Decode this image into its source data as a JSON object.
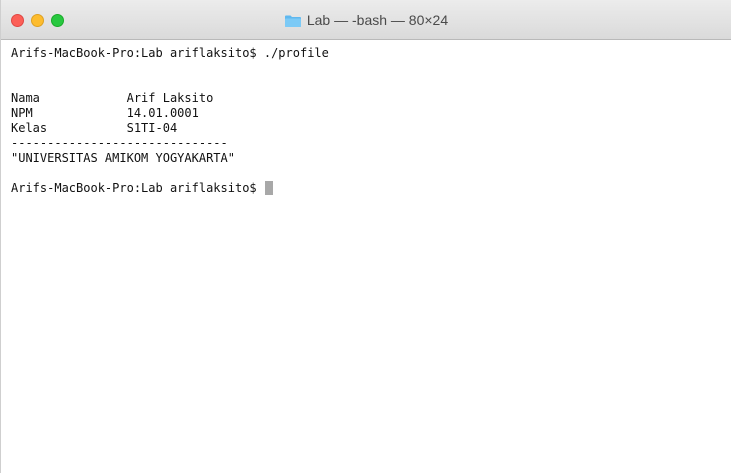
{
  "window": {
    "title": "Lab — -bash — 80×24",
    "folder_icon": "folder-icon",
    "buttons": {
      "close": "close-icon",
      "minimize": "minimize-icon",
      "zoom": "zoom-icon"
    }
  },
  "terminal": {
    "lines": [
      "Arifs-MacBook-Pro:Lab ariflaksito$ ./profile",
      "",
      "",
      "Nama            Arif Laksito",
      "NPM             14.01.0001",
      "Kelas           S1TI-04",
      "------------------------------",
      "\"UNIVERSITAS AMIKOM YOGYAKARTA\"",
      "",
      "Arifs-MacBook-Pro:Lab ariflaksito$ "
    ],
    "cursor": "block-cursor"
  },
  "colors": {
    "close": "#fc5f57",
    "minimize": "#fdbc2e",
    "zoom": "#28c840",
    "text": "#111111",
    "background": "#ffffff",
    "folder": "#5fb8ef"
  }
}
